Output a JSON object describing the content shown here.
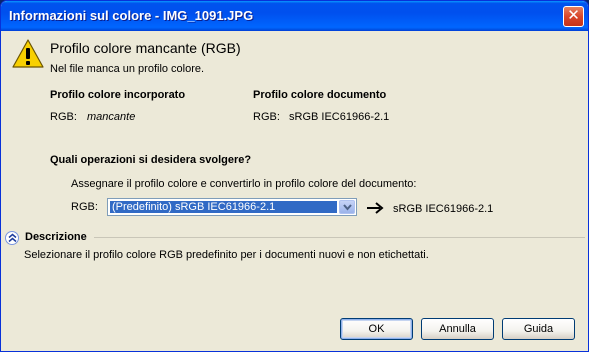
{
  "window": {
    "title": "Informazioni sul colore - IMG_1091.JPG",
    "close_label": "✕"
  },
  "message": {
    "heading": "Profilo colore mancante (RGB)",
    "subtext": "Nel file manca un profilo colore.",
    "icon": "warning-icon"
  },
  "profiles": {
    "embedded_header": "Profilo colore incorporato",
    "embedded_rgb_label": "RGB:",
    "embedded_rgb_value": "mancante",
    "document_header": "Profilo colore documento",
    "document_rgb_label": "RGB:",
    "document_rgb_value": "sRGB IEC61966-2.1"
  },
  "operations": {
    "question": "Quali operazioni si desidera svolgere?",
    "instruction": "Assegnare il profilo colore e convertirlo in profilo colore del documento:",
    "rgb_label": "RGB:",
    "selected_profile": "(Predefinito) sRGB IEC61966-2.1",
    "target_profile": "sRGB IEC61966-2.1"
  },
  "description": {
    "header": "Descrizione",
    "text": "Selezionare il profilo colore RGB predefinito per i documenti nuovi e non etichettati."
  },
  "buttons": {
    "ok": "OK",
    "cancel": "Annulla",
    "help": "Guida"
  },
  "colors": {
    "titlebar": "#0053ee",
    "dialog_bg": "#ece9d8",
    "selection": "#316ac5",
    "close_button": "#d9462a"
  }
}
